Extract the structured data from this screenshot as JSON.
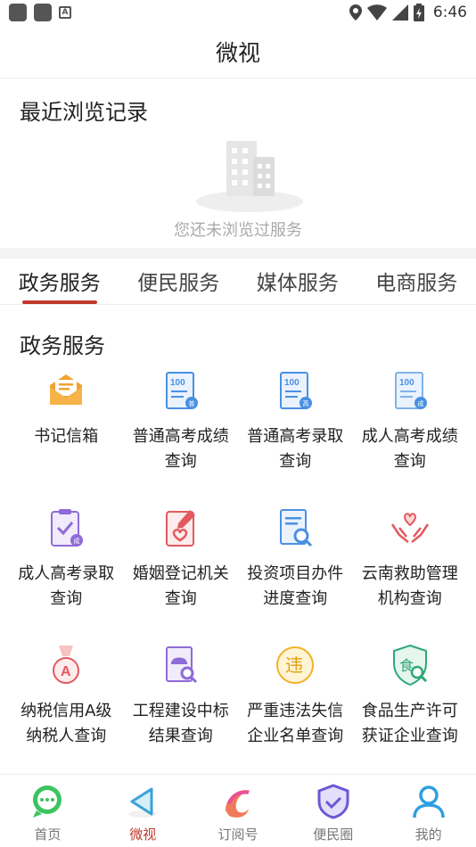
{
  "status_bar": {
    "time": "6:46"
  },
  "header": {
    "title": "微视"
  },
  "recent": {
    "title": "最近浏览记录",
    "empty_text": "您还未浏览过服务"
  },
  "tabs": [
    {
      "label": "政务服务",
      "active": true
    },
    {
      "label": "便民服务",
      "active": false
    },
    {
      "label": "媒体服务",
      "active": false
    },
    {
      "label": "电商服务",
      "active": false
    }
  ],
  "section": {
    "title": "政务服务"
  },
  "services": [
    {
      "label": "书记信箱",
      "icon": "mailbox-icon"
    },
    {
      "label": "普通高考成绩查询",
      "icon": "score-report-icon"
    },
    {
      "label": "普通高考录取查询",
      "icon": "admission-report-icon"
    },
    {
      "label": "成人高考成绩查询",
      "icon": "adult-score-icon"
    },
    {
      "label": "成人高考录取查询",
      "icon": "clipboard-check-icon"
    },
    {
      "label": "婚姻登记机关查询",
      "icon": "marriage-icon"
    },
    {
      "label": "投资项目办件进度查询",
      "icon": "document-search-icon"
    },
    {
      "label": "云南救助管理机构查询",
      "icon": "hands-heart-icon"
    },
    {
      "label": "纳税信用A级纳税人查询",
      "icon": "medal-icon"
    },
    {
      "label": "工程建设中标结果查询",
      "icon": "construction-search-icon"
    },
    {
      "label": "严重违法失信企业名单查询",
      "icon": "violation-icon"
    },
    {
      "label": "食品生产许可获证企业查询",
      "icon": "food-license-icon"
    }
  ],
  "bottom_nav": [
    {
      "label": "首页",
      "icon": "chat-bubble-icon",
      "active": false
    },
    {
      "label": "微视",
      "icon": "play-triangle-icon",
      "active": true
    },
    {
      "label": "订阅号",
      "icon": "swirl-icon",
      "active": false
    },
    {
      "label": "便民圈",
      "icon": "shield-check-icon",
      "active": false
    },
    {
      "label": "我的",
      "icon": "user-icon",
      "active": false
    }
  ],
  "colors": {
    "accent": "#c0392b",
    "tab_underline": "#c0392b"
  }
}
